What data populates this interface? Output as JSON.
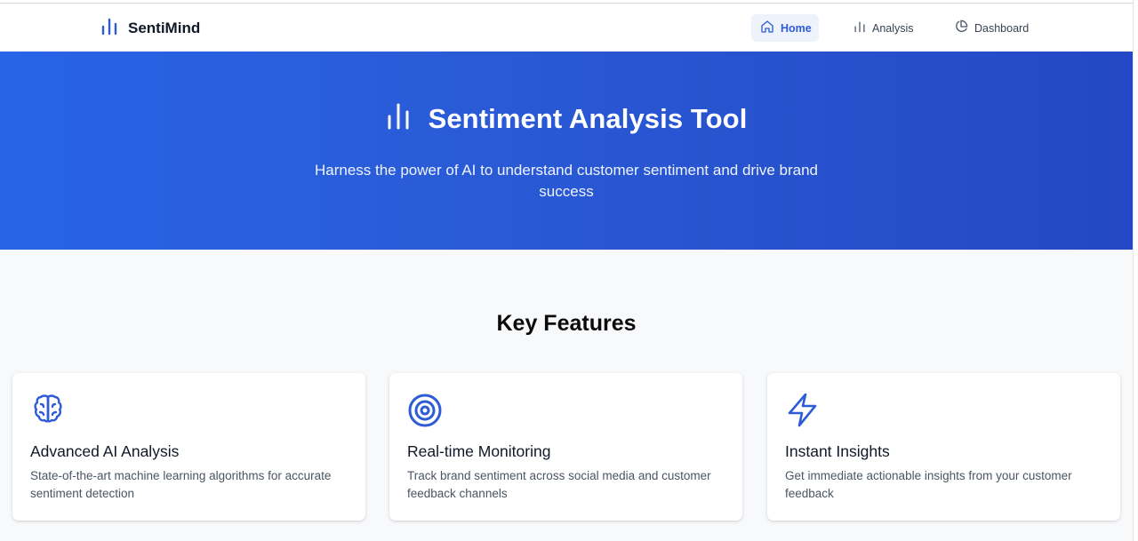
{
  "brand": {
    "name": "SentiMind",
    "icon": "bar-chart-icon"
  },
  "nav": {
    "items": [
      {
        "label": "Home",
        "icon": "home-icon",
        "active": true
      },
      {
        "label": "Analysis",
        "icon": "bar-chart-icon",
        "active": false
      },
      {
        "label": "Dashboard",
        "icon": "pie-chart-icon",
        "active": false
      }
    ]
  },
  "hero": {
    "title": "Sentiment Analysis Tool",
    "subtitle": "Harness the power of AI to understand customer sentiment and drive brand success",
    "icon": "bar-chart-icon"
  },
  "features": {
    "title": "Key Features",
    "cards": [
      {
        "title": "Advanced AI Analysis",
        "description": "State-of-the-art machine learning algorithms for accurate sentiment detection",
        "icon": "brain-icon"
      },
      {
        "title": "Real-time Monitoring",
        "description": "Track brand sentiment across social media and customer feedback channels",
        "icon": "target-icon"
      },
      {
        "title": "Instant Insights",
        "description": "Get immediate actionable insights from your customer feedback",
        "icon": "lightning-icon"
      }
    ]
  },
  "colors": {
    "accent": "#2e5bd6",
    "hero_gradient_start": "#2764e6",
    "hero_gradient_end": "#2448c5",
    "background": "#f8f9fb"
  }
}
